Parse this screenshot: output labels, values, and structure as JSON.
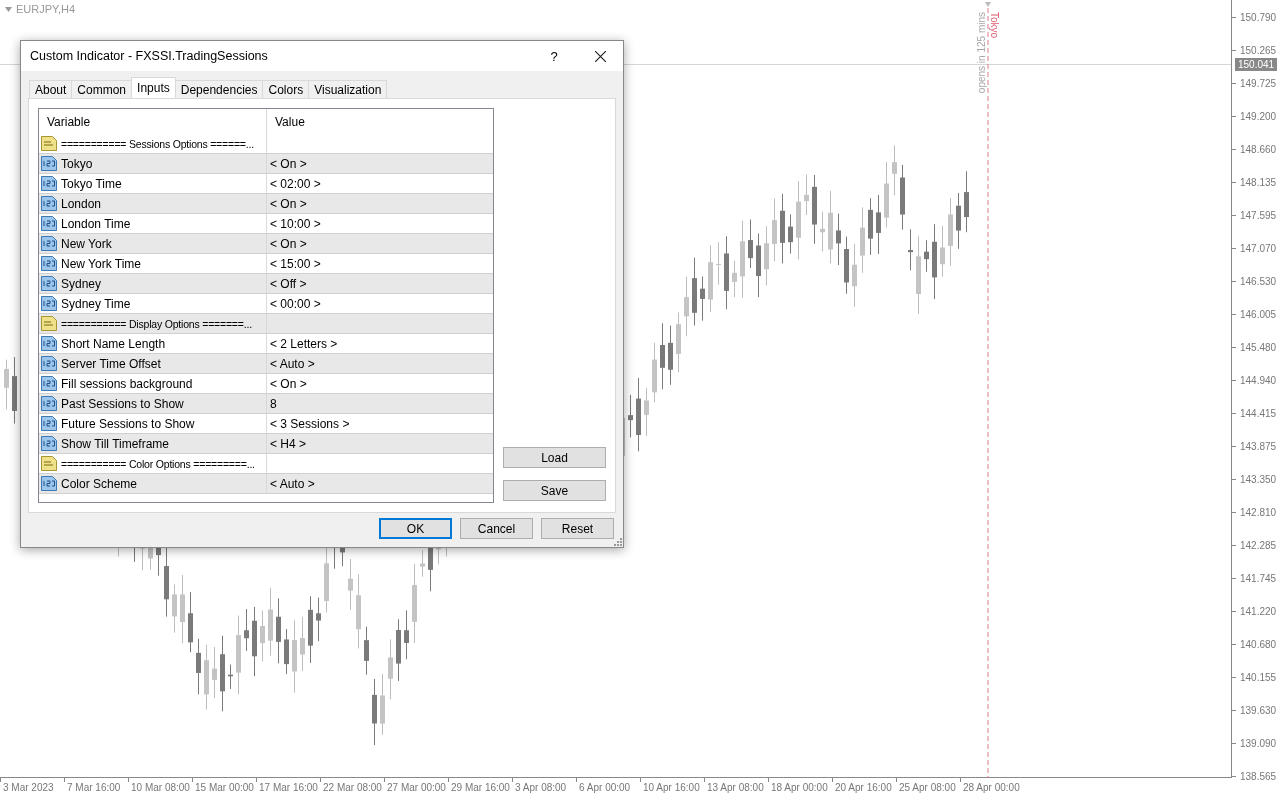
{
  "chart": {
    "symbol": "EURJPY,H4",
    "current_price": "150.041",
    "session_label": "Tokyo",
    "session_note": "opens in 125 mins",
    "price_labels": [
      "150.790",
      "150.265",
      "149.725",
      "149.200",
      "148.660",
      "148.135",
      "147.595",
      "147.070",
      "146.530",
      "146.005",
      "145.480",
      "144.940",
      "144.415",
      "143.875",
      "143.350",
      "142.810",
      "142.285",
      "141.745",
      "141.220",
      "140.680",
      "140.155",
      "139.630",
      "139.090",
      "138.565"
    ],
    "time_labels": [
      "3 Mar 2023",
      "7 Mar 16:00",
      "10 Mar 08:00",
      "15 Mar 00:00",
      "17 Mar 16:00",
      "22 Mar 08:00",
      "27 Mar 00:00",
      "29 Mar 16:00",
      "3 Apr 08:00",
      "6 Apr 00:00",
      "10 Apr 16:00",
      "13 Apr 08:00",
      "18 Apr 00:00",
      "20 Apr 16:00",
      "25 Apr 08:00",
      "28 Apr 00:00"
    ]
  },
  "dialog": {
    "title": "Custom Indicator - FXSSI.TradingSessions",
    "help": "?",
    "tabs": [
      {
        "label": "About",
        "selected": false
      },
      {
        "label": "Common",
        "selected": false
      },
      {
        "label": "Inputs",
        "selected": true
      },
      {
        "label": "Dependencies",
        "selected": false
      },
      {
        "label": "Colors",
        "selected": false
      },
      {
        "label": "Visualization",
        "selected": false
      }
    ],
    "table": {
      "columns": [
        "Variable",
        "Value"
      ],
      "rows": [
        {
          "kind": "group",
          "variable": "=========== Sessions Options ======..."
        },
        {
          "kind": "param",
          "variable": "Tokyo",
          "value": "< On >"
        },
        {
          "kind": "param",
          "variable": "Tokyo Time",
          "value": "< 02:00 >"
        },
        {
          "kind": "param",
          "variable": "London",
          "value": "< On >"
        },
        {
          "kind": "param",
          "variable": "London Time",
          "value": "< 10:00 >"
        },
        {
          "kind": "param",
          "variable": "New York",
          "value": "< On >"
        },
        {
          "kind": "param",
          "variable": "New York Time",
          "value": "< 15:00 >"
        },
        {
          "kind": "param",
          "variable": "Sydney",
          "value": "< Off >"
        },
        {
          "kind": "param",
          "variable": "Sydney Time",
          "value": "< 00:00 >"
        },
        {
          "kind": "group",
          "variable": "=========== Display Options =======..."
        },
        {
          "kind": "param",
          "variable": "Short Name Length",
          "value": "< 2 Letters >"
        },
        {
          "kind": "param",
          "variable": "Server Time Offset",
          "value": "< Auto >"
        },
        {
          "kind": "param",
          "variable": "Fill sessions background",
          "value": "< On >"
        },
        {
          "kind": "param",
          "variable": "Past Sessions to Show",
          "value": "8"
        },
        {
          "kind": "param",
          "variable": "Future Sessions to Show",
          "value": "< 3 Sessions >"
        },
        {
          "kind": "param",
          "variable": "Show Till Timeframe",
          "value": "< H4 >"
        },
        {
          "kind": "group",
          "variable": "=========== Color Options =========..."
        },
        {
          "kind": "param",
          "variable": "Color Scheme",
          "value": "< Auto >"
        }
      ]
    },
    "side_buttons": [
      "Load",
      "Save"
    ],
    "buttons": [
      {
        "label": "OK",
        "default": true
      },
      {
        "label": "Cancel",
        "default": false
      },
      {
        "label": "Reset",
        "default": false
      }
    ]
  }
}
